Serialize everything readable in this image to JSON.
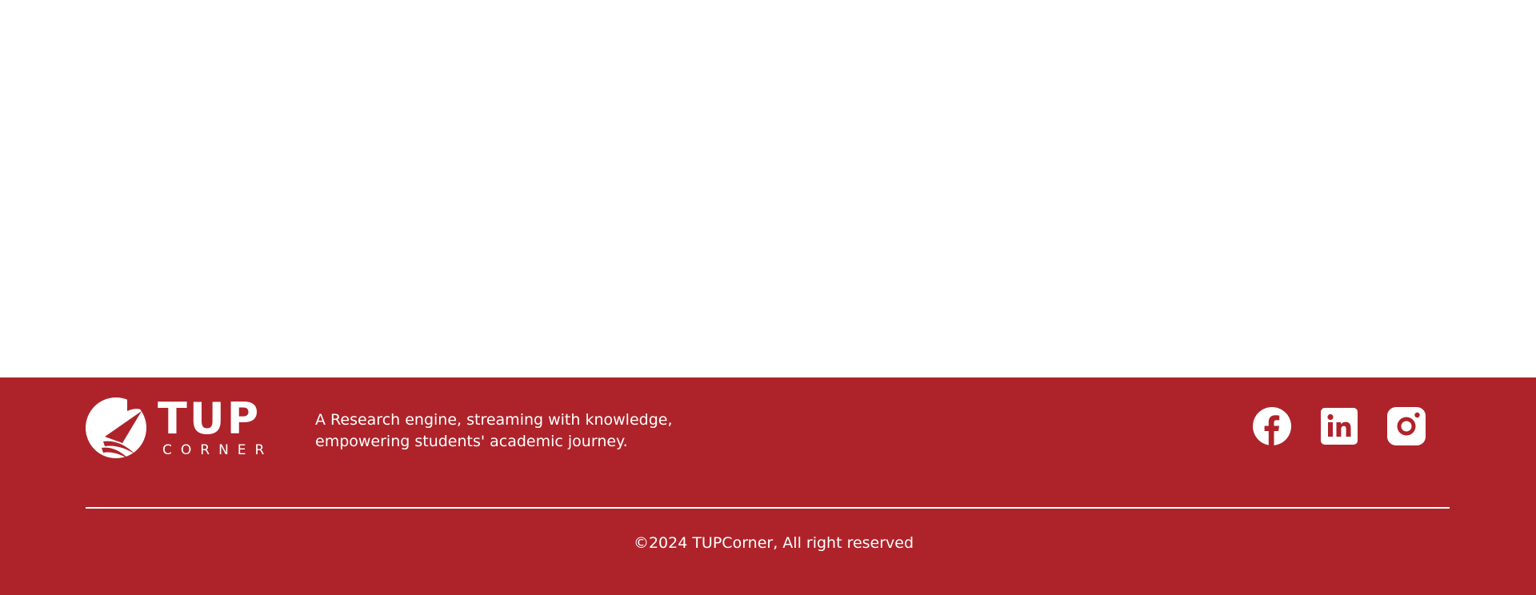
{
  "footer": {
    "logo": {
      "main": "TUP",
      "sub": "CORNER"
    },
    "tagline": {
      "line1": "A Research engine, streaming with knowledge,",
      "line2": "empowering students' academic journey."
    },
    "socials": [
      {
        "name": "facebook-icon",
        "label": "Facebook"
      },
      {
        "name": "linkedin-icon",
        "label": "LinkedIn"
      },
      {
        "name": "instagram-icon",
        "label": "Instagram"
      }
    ],
    "copyright": "©2024 TUPCorner, All right reserved"
  },
  "colors": {
    "footer_bg": "#ae232a",
    "foreground": "#ffffff",
    "page_bg": "#ffffff"
  }
}
